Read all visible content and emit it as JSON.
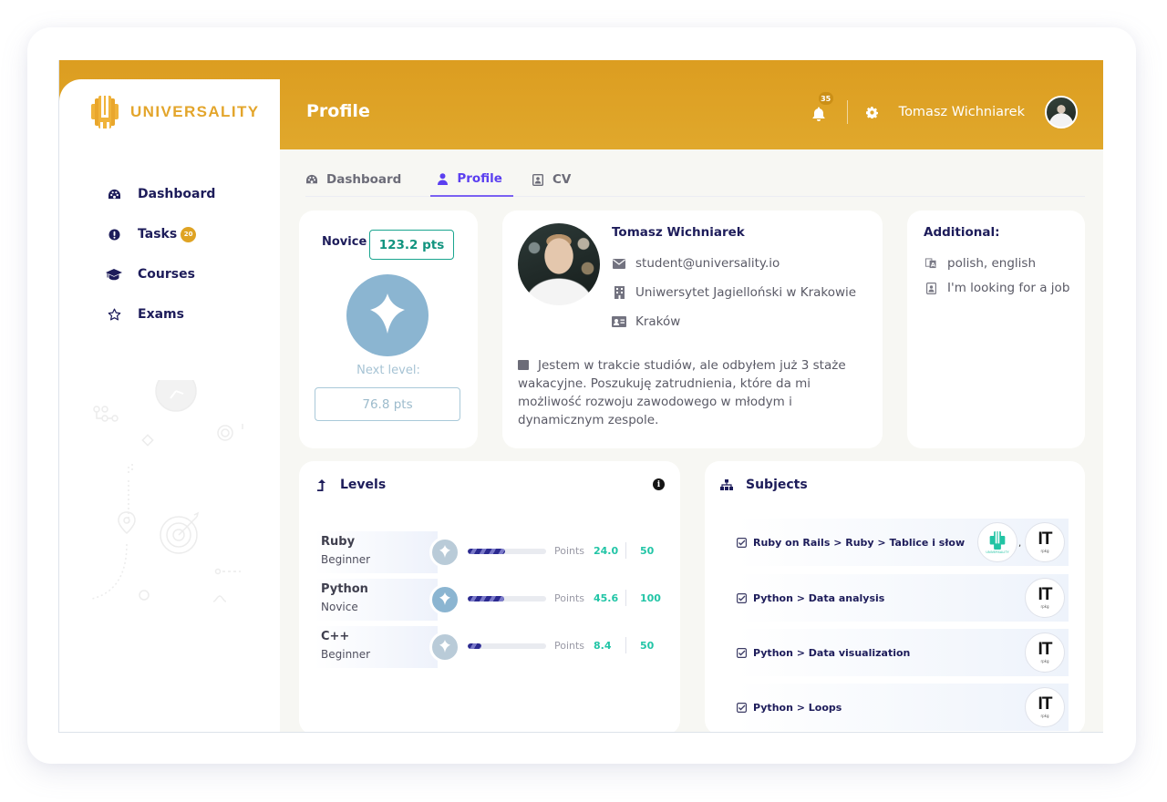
{
  "brand": {
    "name": "UNIVERSALITY",
    "color": "#e3a52b"
  },
  "header": {
    "title": "Profile",
    "notifications_count": "35",
    "user_name": "Tomasz Wichniarek",
    "bar_color": "#dc9d20"
  },
  "sidebar": {
    "items": [
      {
        "label": "Dashboard",
        "icon": "dashboard-gauge-icon"
      },
      {
        "label": "Tasks",
        "icon": "exclamation-circle-icon",
        "badge": "20"
      },
      {
        "label": "Courses",
        "icon": "graduation-cap-icon"
      },
      {
        "label": "Exams",
        "icon": "star-outline-icon"
      }
    ]
  },
  "tabs": [
    {
      "label": "Dashboard",
      "icon": "dashboard-gauge-icon",
      "active": false
    },
    {
      "label": "Profile",
      "icon": "user-icon",
      "active": true
    },
    {
      "label": "CV",
      "icon": "id-badge-icon",
      "active": false
    }
  ],
  "level_card": {
    "level": "Novice",
    "points": "123.2 pts",
    "next_level_label": "Next level:",
    "next_level_points": "76.8 pts"
  },
  "profile": {
    "name": "Tomasz Wichniarek",
    "email": "student@universality.io",
    "university": "Uniwersytet Jagielloński w Krakowie",
    "city": "Kraków",
    "bio": "Jestem w trakcie studiów, ale odbyłem już 3 staże wakacyjne. Poszukuję zatrudnienia, które da mi możliwość rozwoju zawodowego w młodym i dynamicznym zespole."
  },
  "additional": {
    "title": "Additional:",
    "languages": "polish, english",
    "job_status": "I'm looking for a job"
  },
  "levels": {
    "title": "Levels",
    "points_label": "Points",
    "items": [
      {
        "name": "Ruby",
        "level": "Beginner",
        "points": "24.0",
        "max": "50",
        "progress": 0.48,
        "badge_color": "#b9cbd8"
      },
      {
        "name": "Python",
        "level": "Novice",
        "points": "45.6",
        "max": "100",
        "progress": 0.46,
        "badge_color": "#8bb5d1"
      },
      {
        "name": "C++",
        "level": "Beginner",
        "points": "8.4",
        "max": "50",
        "progress": 0.17,
        "badge_color": "#b9cbd8"
      }
    ]
  },
  "subjects": {
    "title": "Subjects",
    "items": [
      {
        "label": "Ruby on Rails > Ruby > Tablice i słow",
        "providers": [
          "UNIVERSALITY",
          "IT"
        ]
      },
      {
        "label": "Python > Data analysis",
        "providers": [
          "IT"
        ]
      },
      {
        "label": "Python > Data visualization",
        "providers": [
          "IT"
        ]
      },
      {
        "label": "Python > Loops",
        "providers": [
          "IT"
        ]
      }
    ],
    "it_logo_text": "IT",
    "it_logo_sub": "rpkg",
    "universality_logo_text": "UNIVERSALITY"
  }
}
